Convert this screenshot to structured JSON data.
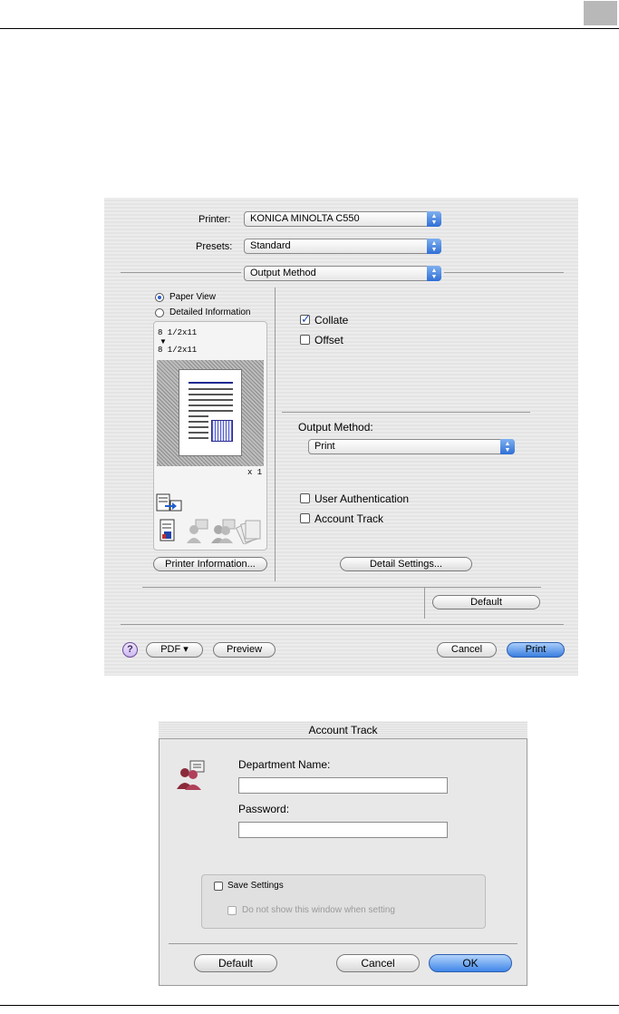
{
  "print_dialog": {
    "printer_label": "Printer:",
    "printer_value": "KONICA MINOLTA C550",
    "presets_label": "Presets:",
    "presets_value": "Standard",
    "panel_value": "Output Method",
    "view_options": [
      "Paper View",
      "Detailed Information"
    ],
    "selected_view": "Paper View",
    "paper_size_top": "8 1/2x11",
    "paper_size_bottom": "8 1/2x11",
    "copies": "x 1",
    "collate_label": "Collate",
    "collate_checked": true,
    "offset_label": "Offset",
    "offset_checked": false,
    "output_method_label": "Output Method:",
    "output_method_value": "Print",
    "user_auth_label": "User Authentication",
    "user_auth_checked": false,
    "account_track_label": "Account Track",
    "account_track_checked": false,
    "printer_info_button": "Printer Information...",
    "detail_settings_button": "Detail Settings...",
    "default_button": "Default",
    "help_label": "?",
    "pdf_button": "PDF ▾",
    "preview_button": "Preview",
    "cancel_button": "Cancel",
    "print_button": "Print",
    "accent_color": "#3a7fe0"
  },
  "account_track_dialog": {
    "title": "Account Track",
    "department_label": "Department Name:",
    "department_value": "",
    "password_label": "Password:",
    "password_value": "",
    "save_settings_label": "Save Settings",
    "save_settings_checked": false,
    "do_not_show_label": "Do not show this window when setting",
    "do_not_show_checked": false,
    "default_button": "Default",
    "cancel_button": "Cancel",
    "ok_button": "OK"
  }
}
